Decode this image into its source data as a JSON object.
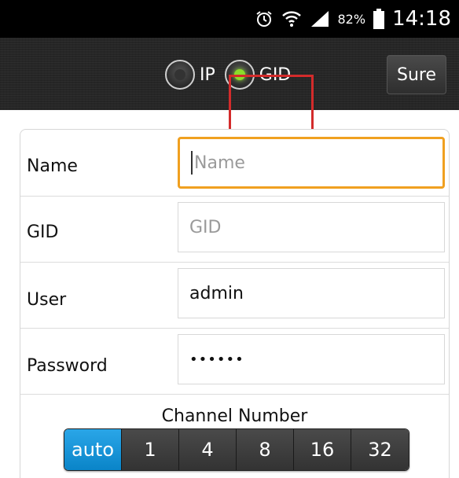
{
  "status_bar": {
    "battery_percent": "82%",
    "time": "14:18",
    "icons": [
      "alarm-icon",
      "wifi-icon",
      "signal-icon",
      "battery-icon"
    ]
  },
  "header": {
    "mode_options": [
      {
        "label": "IP",
        "selected": false
      },
      {
        "label": "GID",
        "selected": true
      }
    ],
    "sure_label": "Sure"
  },
  "form": {
    "name": {
      "label": "Name",
      "value": "",
      "placeholder": "Name"
    },
    "gid": {
      "label": "GID",
      "value": "",
      "placeholder": "GID"
    },
    "user": {
      "label": "User",
      "value": "admin"
    },
    "password": {
      "label": "Password",
      "value": "••••••"
    }
  },
  "channel": {
    "title": "Channel Number",
    "options": [
      "auto",
      "1",
      "4",
      "8",
      "16",
      "32"
    ],
    "selected": "auto"
  },
  "colors": {
    "focus_border": "#f0a020",
    "active_segment": "#0a84c8",
    "radio_on": "#8bdc2a",
    "highlight_box": "#d32b2b"
  }
}
